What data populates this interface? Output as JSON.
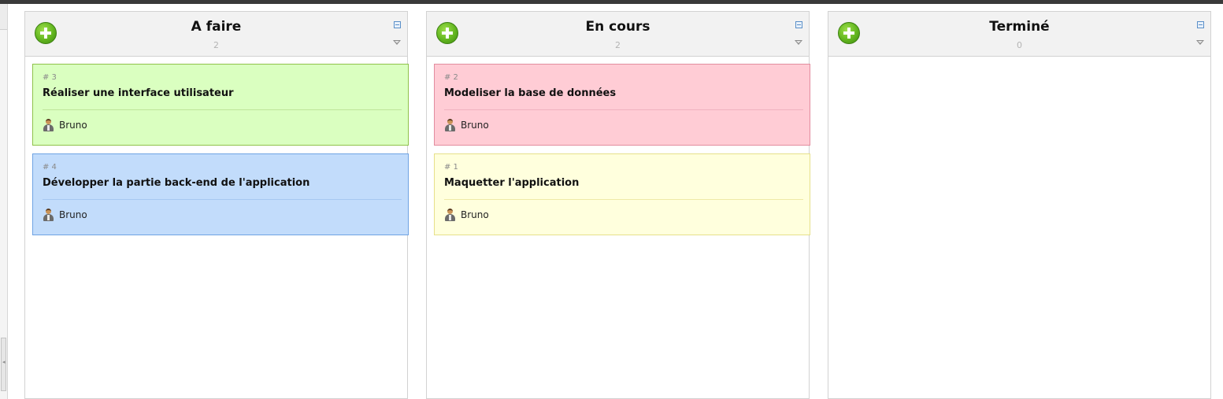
{
  "colors": {
    "green_card_bg": "#daffc0",
    "green_card_border": "#8fc24a",
    "blue_card_bg": "#c2dcfb",
    "blue_card_border": "#6fa3e3",
    "pink_card_bg": "#ffccd5",
    "pink_card_border": "#e28c9e",
    "yellow_card_bg": "#ffffdd",
    "yellow_card_border": "#e6e08a",
    "add_button": "#62b51f"
  },
  "icons": {
    "add": "plus-circle-icon",
    "collapse": "collapse-icon",
    "menu": "dropdown-arrow-icon",
    "user": "user-icon"
  },
  "columns": [
    {
      "title": "A faire",
      "count": "2",
      "cards": [
        {
          "number": "# 3",
          "title": "Réaliser une interface utilisateur",
          "assignee": "Bruno",
          "color": "green"
        },
        {
          "number": "# 4",
          "title": "Développer la partie back-end de l'application",
          "assignee": "Bruno",
          "color": "blue"
        }
      ]
    },
    {
      "title": "En cours",
      "count": "2",
      "cards": [
        {
          "number": "# 2",
          "title": "Modeliser la base de données",
          "assignee": "Bruno",
          "color": "pink"
        },
        {
          "number": "# 1",
          "title": "Maquetter l'application",
          "assignee": "Bruno",
          "color": "yellow"
        }
      ]
    },
    {
      "title": "Terminé",
      "count": "0",
      "cards": []
    }
  ]
}
